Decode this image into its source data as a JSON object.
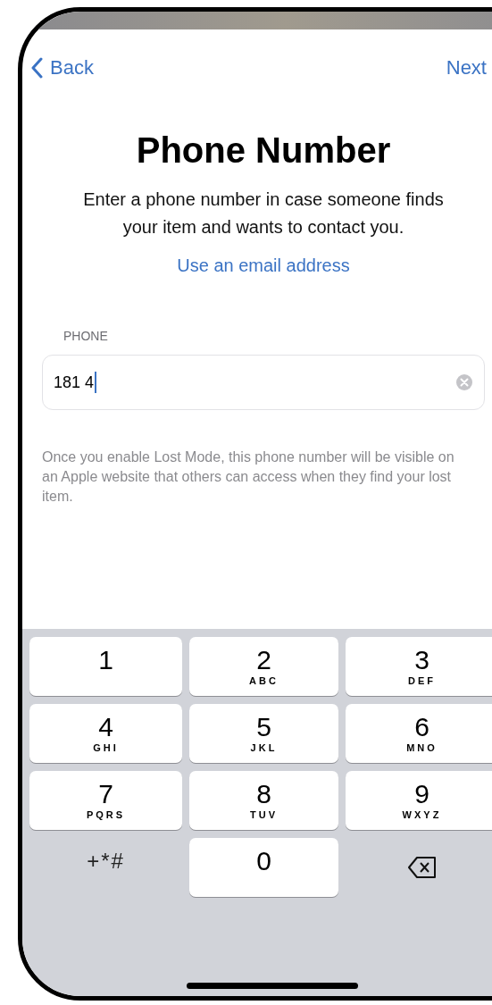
{
  "nav": {
    "back": "Back",
    "next": "Next"
  },
  "title": "Phone Number",
  "description": "Enter a phone number in case someone finds your item and wants to contact you.",
  "alt_link": "Use an email address",
  "field": {
    "label": "PHONE",
    "value": "181 4",
    "focused": true
  },
  "footnote": "Once you enable Lost Mode, this phone number will be visible on an Apple website that others can access when they find your lost item.",
  "keypad": [
    {
      "kind": "digit",
      "digit": "1"
    },
    {
      "kind": "digit",
      "digit": "2",
      "letters": "ABC"
    },
    {
      "kind": "digit",
      "digit": "3",
      "letters": "DEF"
    },
    {
      "kind": "digit",
      "digit": "4",
      "letters": "GHI"
    },
    {
      "kind": "digit",
      "digit": "5",
      "letters": "JKL"
    },
    {
      "kind": "digit",
      "digit": "6",
      "letters": "MNO"
    },
    {
      "kind": "digit",
      "digit": "7",
      "letters": "PQRS"
    },
    {
      "kind": "digit",
      "digit": "8",
      "letters": "TUV"
    },
    {
      "kind": "digit",
      "digit": "9",
      "letters": "WXYZ"
    },
    {
      "kind": "symbols",
      "label": "+*#"
    },
    {
      "kind": "digit",
      "digit": "0"
    },
    {
      "kind": "delete"
    }
  ]
}
